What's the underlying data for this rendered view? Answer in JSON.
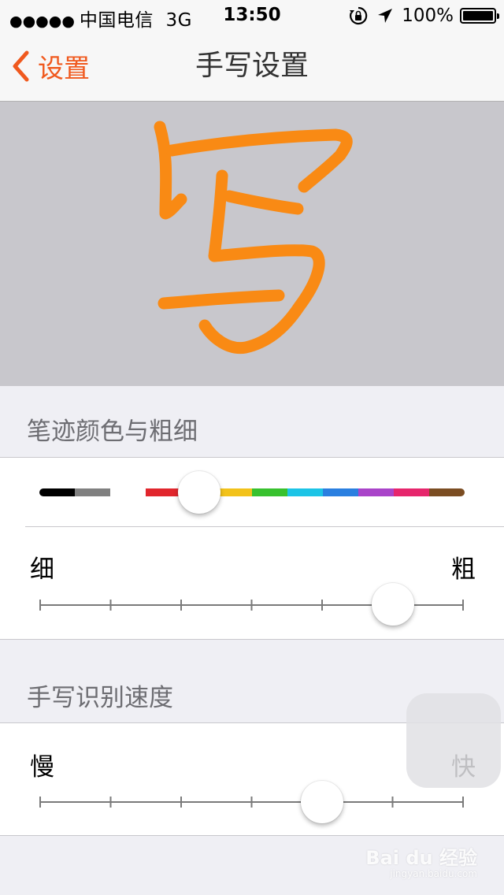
{
  "status_bar": {
    "signal": "●●●●●",
    "carrier": "中国电信",
    "network": "3G",
    "time": "13:50",
    "battery": "100%",
    "battery_level": 1.0,
    "icons": [
      "rotation-lock-icon",
      "location-arrow-icon",
      "battery-icon"
    ]
  },
  "nav": {
    "back_label": "设置",
    "title": "手写设置"
  },
  "preview": {
    "stroke_color": "#f98a14",
    "background": "#c8c7cc"
  },
  "stroke_section": {
    "header": "笔迹颜色与粗细",
    "palette": [
      "#000000",
      "#808080",
      "#ffffff",
      "#e1262d",
      "#f98a14",
      "#f2c21a",
      "#38c12e",
      "#1cc4e6",
      "#2a7fe0",
      "#a944c9",
      "#e6266c",
      "#7b4d22"
    ],
    "selected_color": "#f98a14",
    "thin_label": "细",
    "thick_label": "粗",
    "thickness_steps": 7,
    "thickness_value": 5
  },
  "speed_section": {
    "header": "手写识别速度",
    "slow_label": "慢",
    "fast_label": "快",
    "speed_steps": 7,
    "speed_value": 4
  },
  "watermark": {
    "text": "Bai du 经验",
    "sub": "jingyan.baidu.com"
  }
}
